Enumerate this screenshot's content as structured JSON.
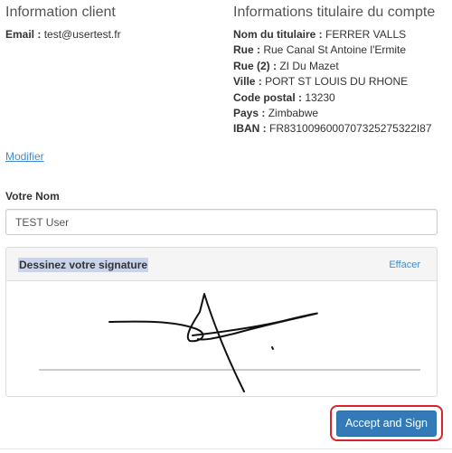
{
  "client": {
    "title": "Information client",
    "email_label": "Email :",
    "email_value": "test@usertest.fr"
  },
  "holder": {
    "title": "Informations titulaire du compte",
    "fields": [
      {
        "label": "Nom du titulaire :",
        "value": "FERRER VALLS"
      },
      {
        "label": "Rue :",
        "value": "Rue Canal St Antoine l'Ermite"
      },
      {
        "label": "Rue (2) :",
        "value": "ZI Du Mazet"
      },
      {
        "label": "Ville :",
        "value": "PORT ST LOUIS DU RHONE"
      },
      {
        "label": "Code postal :",
        "value": "13230"
      },
      {
        "label": "Pays :",
        "value": "Zimbabwe"
      },
      {
        "label": "IBAN :",
        "value": "FR8310096000707325275322I87"
      }
    ]
  },
  "modify_link": "Modifier",
  "name_field": {
    "label": "Votre Nom",
    "value": "TEST User"
  },
  "signature": {
    "title": "Dessinez votre signature",
    "clear_label": "Effacer"
  },
  "accept_button": "Accept and Sign",
  "colors": {
    "link": "#428bca",
    "primary_button": "#337ab7",
    "highlight_border": "#d9232d"
  }
}
